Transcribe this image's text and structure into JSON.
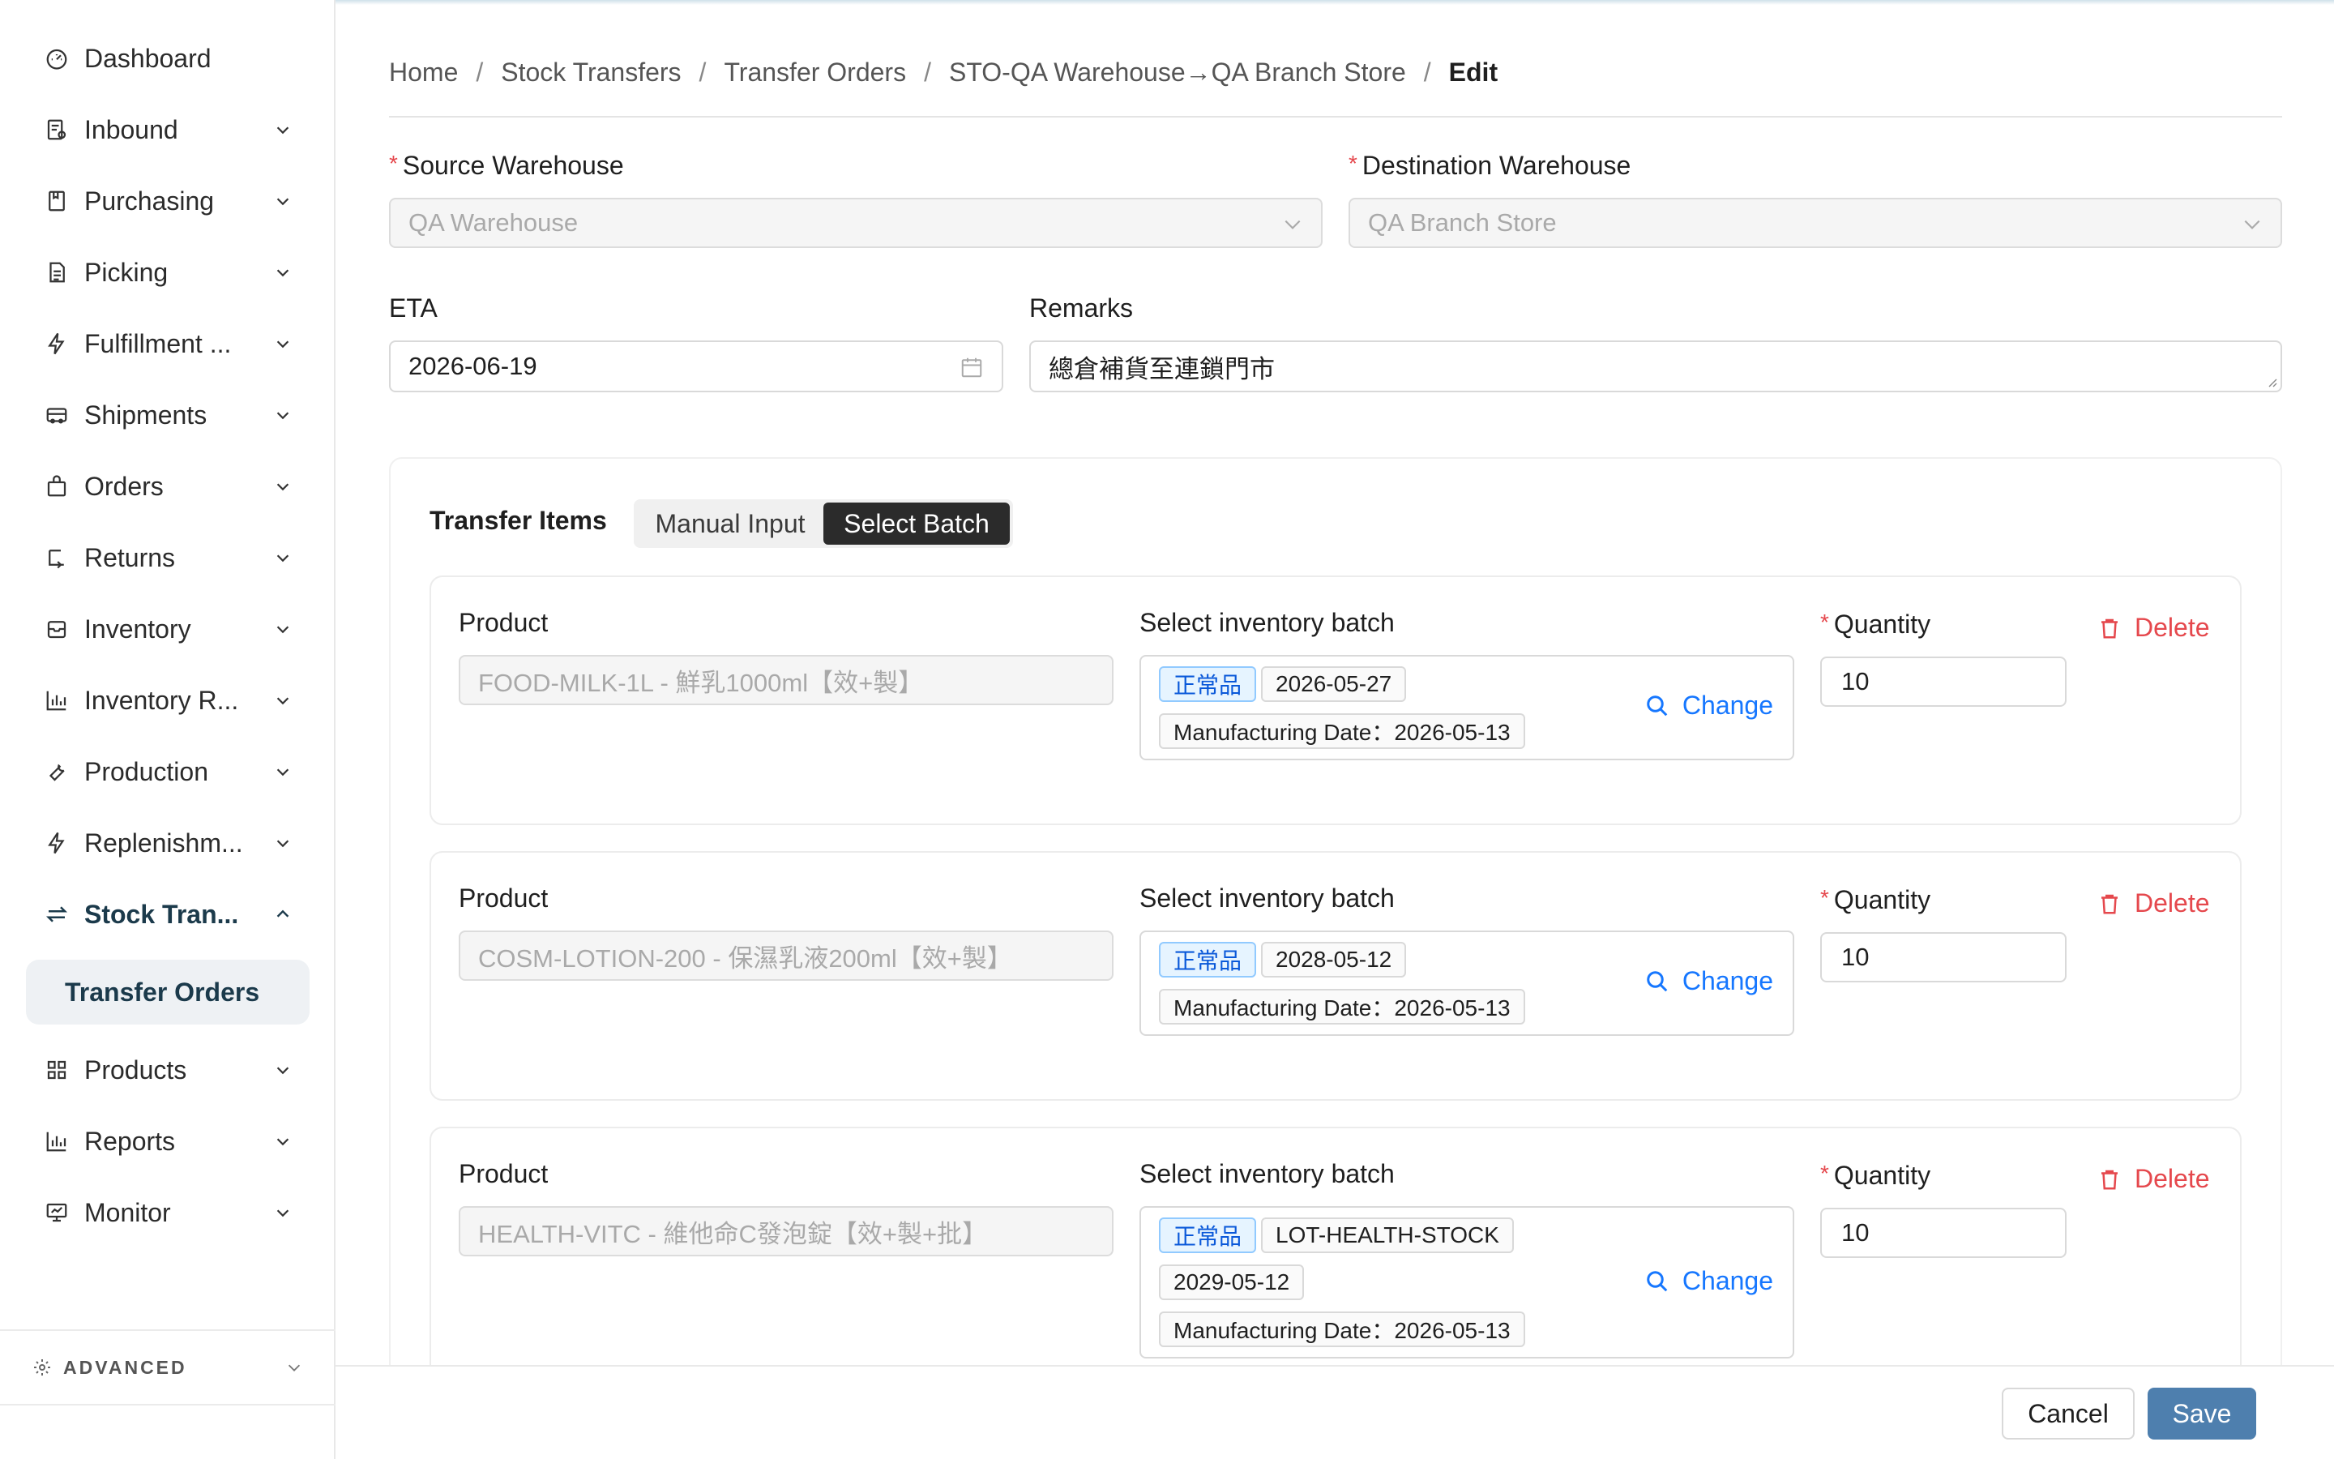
{
  "sidebar": {
    "items": [
      {
        "label": "Dashboard",
        "icon": "dashboard-icon",
        "has_chevron": false
      },
      {
        "label": "Inbound",
        "icon": "inbound-icon",
        "has_chevron": true
      },
      {
        "label": "Purchasing",
        "icon": "purchasing-icon",
        "has_chevron": true
      },
      {
        "label": "Picking",
        "icon": "picking-icon",
        "has_chevron": true
      },
      {
        "label": "Fulfillment ...",
        "icon": "lightning-icon",
        "has_chevron": true
      },
      {
        "label": "Shipments",
        "icon": "truck-icon",
        "has_chevron": true
      },
      {
        "label": "Orders",
        "icon": "bag-icon",
        "has_chevron": true
      },
      {
        "label": "Returns",
        "icon": "return-icon",
        "has_chevron": true
      },
      {
        "label": "Inventory",
        "icon": "inventory-icon",
        "has_chevron": true
      },
      {
        "label": "Inventory R...",
        "icon": "bar-chart-icon",
        "has_chevron": true
      },
      {
        "label": "Production",
        "icon": "wrench-icon",
        "has_chevron": true
      },
      {
        "label": "Replenishm...",
        "icon": "lightning-icon",
        "has_chevron": true
      },
      {
        "label": "Stock Tran...",
        "icon": "transfer-icon",
        "has_chevron": true,
        "expanded": true
      },
      {
        "label": "Products",
        "icon": "grid-icon",
        "has_chevron": true
      },
      {
        "label": "Reports",
        "icon": "bar-chart-icon",
        "has_chevron": true
      },
      {
        "label": "Monitor",
        "icon": "monitor-icon",
        "has_chevron": true
      }
    ],
    "sub_item": "Transfer Orders",
    "advanced_label": "ADVANCED"
  },
  "breadcrumb": [
    "Home",
    "Stock Transfers",
    "Transfer Orders",
    "STO-QA Warehouse→QA Branch Store",
    "Edit"
  ],
  "form": {
    "source_label": "Source Warehouse",
    "source_value": "QA Warehouse",
    "dest_label": "Destination Warehouse",
    "dest_value": "QA Branch Store",
    "eta_label": "ETA",
    "eta_value": "2026-06-19",
    "remarks_label": "Remarks",
    "remarks_value": "總倉補貨至連鎖門市"
  },
  "items_section": {
    "title": "Transfer Items",
    "modes": [
      "Manual Input",
      "Select Batch"
    ],
    "active_mode": "Select Batch",
    "product_label": "Product",
    "batch_label": "Select inventory batch",
    "quantity_label": "Quantity",
    "change_label": "Change",
    "delete_label": "Delete",
    "rows": [
      {
        "product": "FOOD-MILK-1L - 鮮乳1000ml【效+製】",
        "status": "正常品",
        "lot": "",
        "expiry": "2026-05-27",
        "mfg": "Manufacturing Date：2026-05-13",
        "quantity": "10"
      },
      {
        "product": "COSM-LOTION-200 - 保濕乳液200ml【效+製】",
        "status": "正常品",
        "lot": "",
        "expiry": "2028-05-12",
        "mfg": "Manufacturing Date：2026-05-13",
        "quantity": "10"
      },
      {
        "product": "HEALTH-VITC - 維他命C發泡錠【效+製+批】",
        "status": "正常品",
        "lot": "LOT-HEALTH-STOCK",
        "expiry": "2029-05-12",
        "mfg": "Manufacturing Date：2026-05-13",
        "quantity": "10"
      }
    ]
  },
  "footer": {
    "cancel_label": "Cancel",
    "save_label": "Save"
  },
  "colors": {
    "accent": "#1677ff",
    "danger": "#e5484d",
    "save": "#4e7fae",
    "active_nav": "#1b3a4b"
  }
}
